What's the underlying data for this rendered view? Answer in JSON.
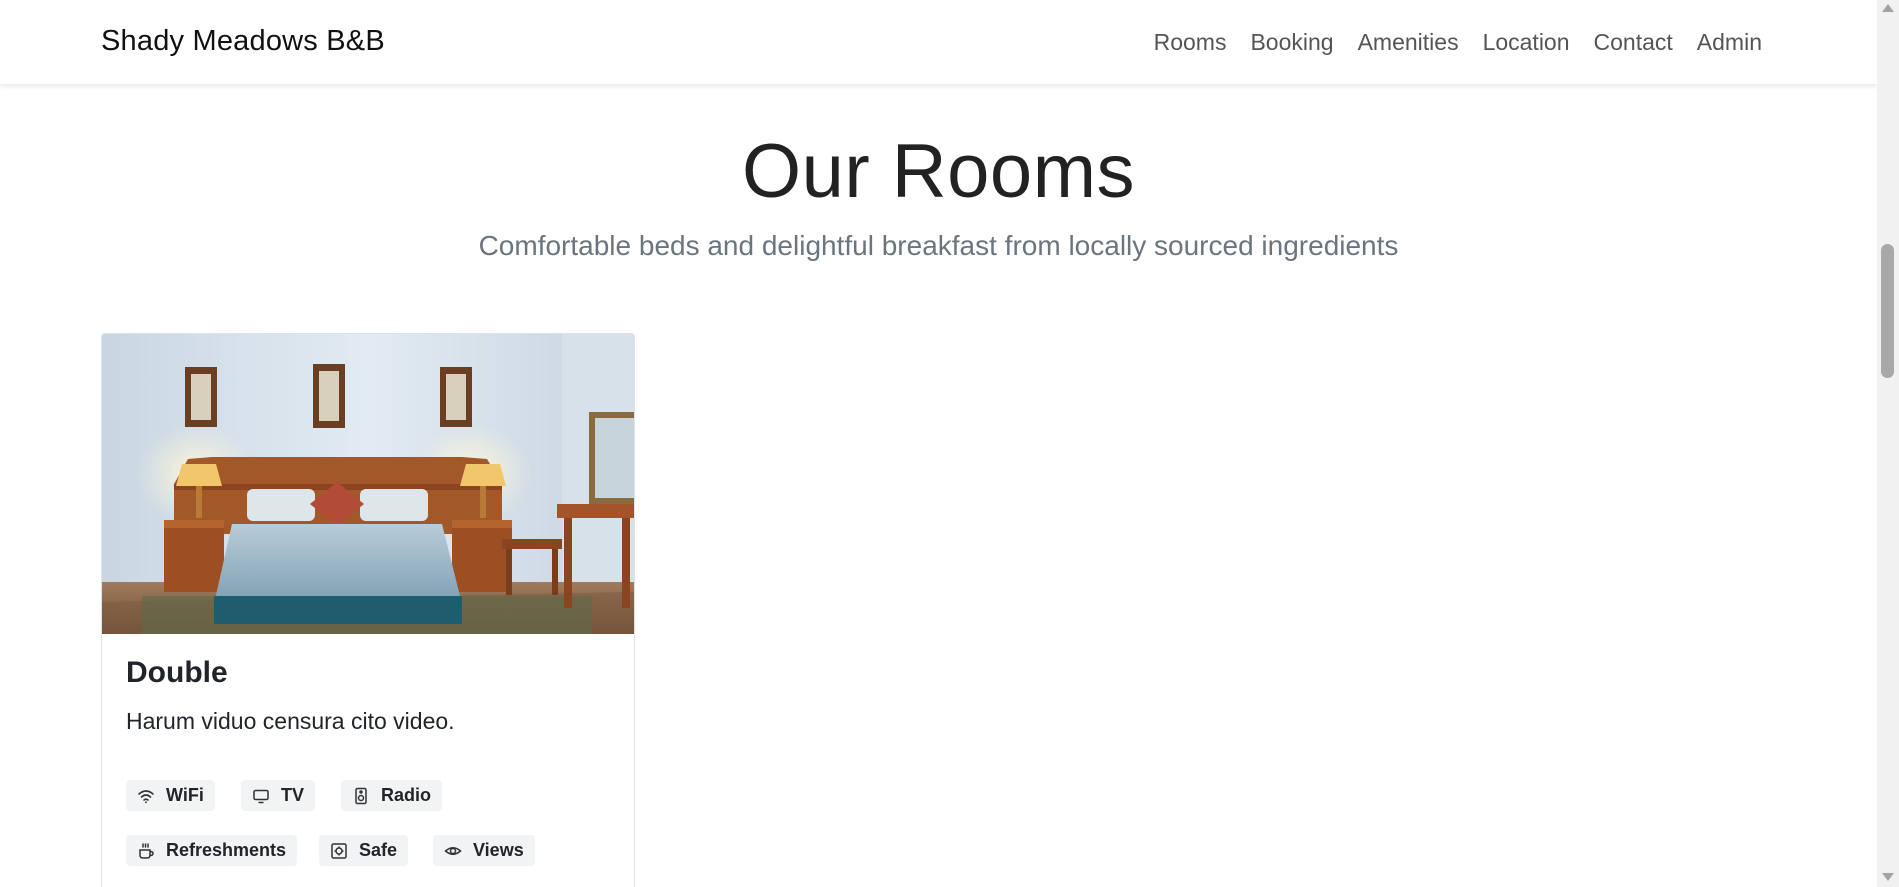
{
  "navbar": {
    "brand": "Shady Meadows B&B",
    "links": [
      "Rooms",
      "Booking",
      "Amenities",
      "Location",
      "Contact",
      "Admin"
    ]
  },
  "hero": {
    "title": "Our Rooms",
    "subtitle": "Comfortable beds and delightful breakfast from locally sourced ingredients"
  },
  "room": {
    "name": "Double",
    "description": "Harum viduo censura cito video.",
    "amenities": [
      {
        "label": "WiFi",
        "icon": "wifi-icon"
      },
      {
        "label": "TV",
        "icon": "tv-icon"
      },
      {
        "label": "Radio",
        "icon": "radio-icon"
      },
      {
        "label": "Refreshments",
        "icon": "cup-icon"
      },
      {
        "label": "Safe",
        "icon": "safe-icon"
      },
      {
        "label": "Views",
        "icon": "eye-icon"
      }
    ]
  },
  "colors": {
    "text": "#212529",
    "muted": "#6c757d",
    "chip_bg": "#f1f3f5"
  }
}
